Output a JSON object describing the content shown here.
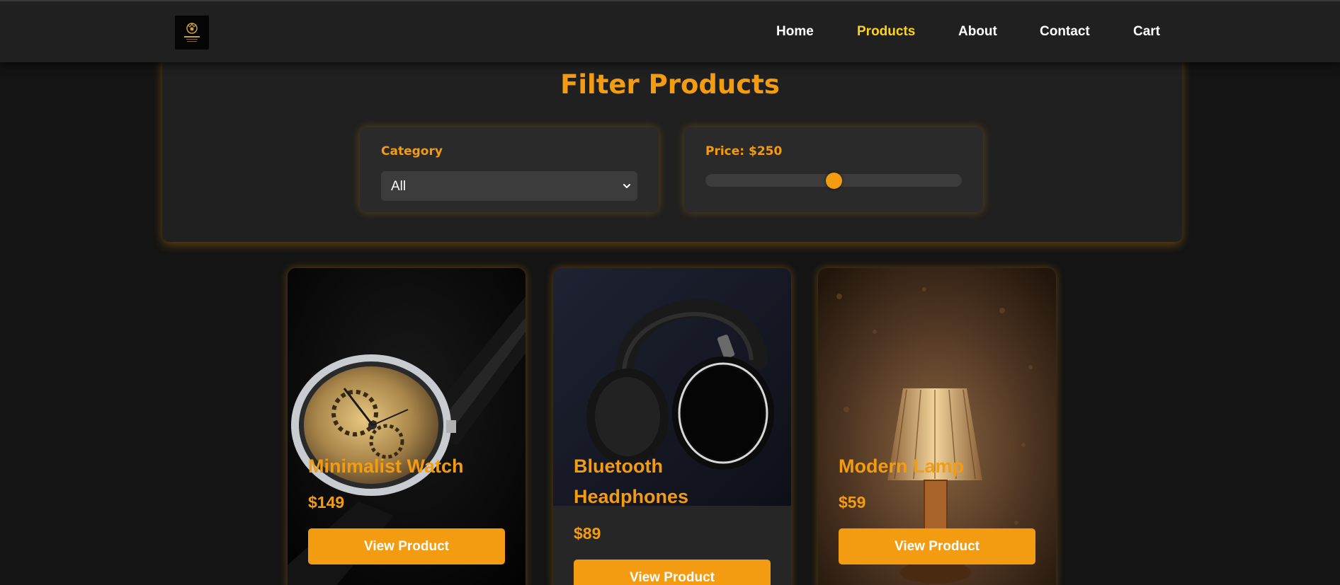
{
  "nav": {
    "items": [
      {
        "label": "Home"
      },
      {
        "label": "Products",
        "active": true
      },
      {
        "label": "About"
      },
      {
        "label": "Contact"
      },
      {
        "label": "Cart"
      }
    ]
  },
  "filter": {
    "title": "Filter Products",
    "category_label": "Category",
    "category_selected": "All",
    "price_label": "Price: $250",
    "price_slider_fraction": 0.5
  },
  "products": [
    {
      "name": "Minimalist Watch",
      "price": "$149",
      "button": "View Product",
      "image": "watch"
    },
    {
      "name": "Bluetooth Headphones",
      "price": "$89",
      "button": "View Product",
      "image": "headphones"
    },
    {
      "name": "Modern Lamp",
      "price": "$59",
      "button": "View Product",
      "image": "lamp"
    }
  ],
  "colors": {
    "accent": "#f39c12",
    "active_nav": "#ffd21a",
    "background": "#141414",
    "panel": "#202020"
  }
}
